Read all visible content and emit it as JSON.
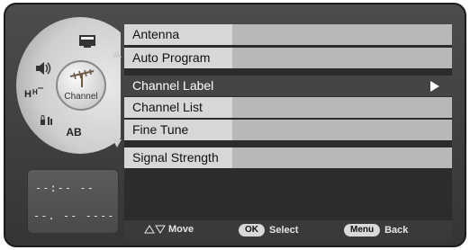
{
  "menu": {
    "items": [
      {
        "label": "Antenna"
      },
      {
        "label": "Auto Program"
      },
      {
        "label": "Channel Label",
        "selected": true
      },
      {
        "label": "Channel List"
      },
      {
        "label": "Fine Tune"
      },
      {
        "label": "Signal Strength"
      }
    ]
  },
  "dial": {
    "hub_label": "Channel",
    "badges": {
      "ab": "AB"
    }
  },
  "clock": {
    "time": "--:-- --",
    "date": "--. -- ----"
  },
  "footer": {
    "move_label": "Move",
    "ok_key": "OK",
    "select_label": "Select",
    "menu_key": "Menu",
    "back_label": "Back"
  }
}
